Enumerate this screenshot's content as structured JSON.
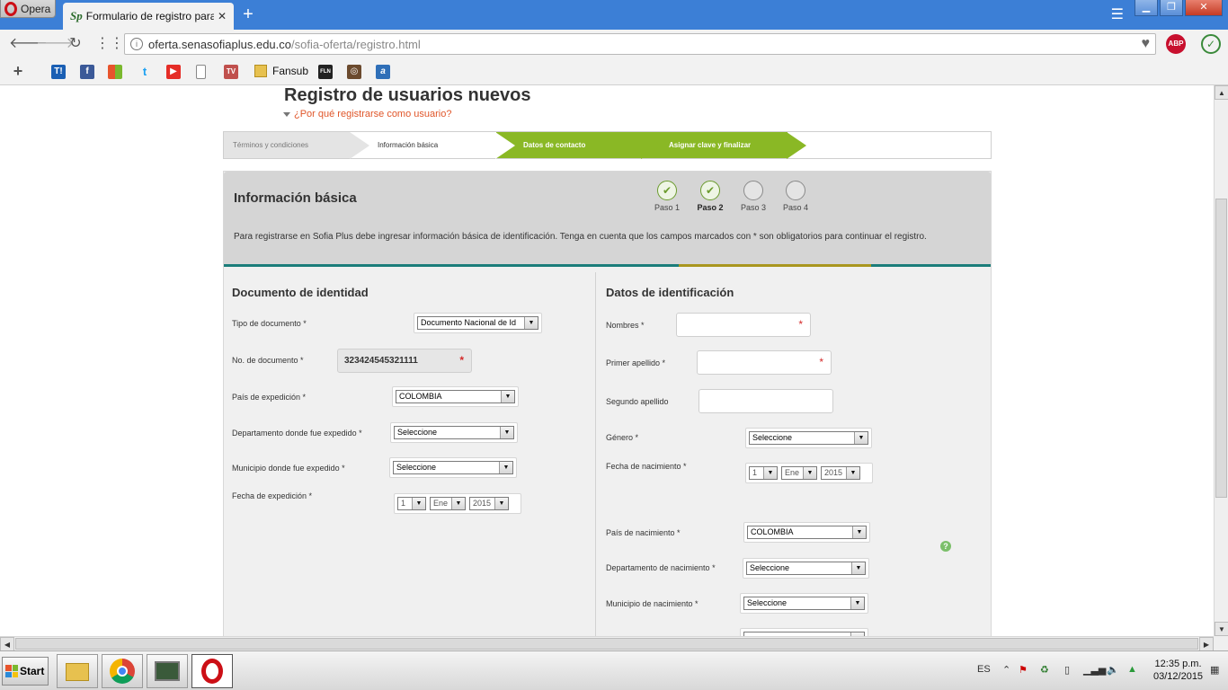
{
  "browser": {
    "menu_label": "Opera",
    "tab_title": "Formulario de registro para ι",
    "tab_favicon": "Sp",
    "url_domain": "oferta.senasofiaplus.edu.co",
    "url_path": "/sofia-oferta/registro.html",
    "abp_label": "ABP",
    "bookmarks": {
      "fansub_label": "Fansub",
      "items": [
        {
          "icon": "T!",
          "color": "#1a5fb4"
        },
        {
          "icon": "f",
          "color": "#3b5998"
        },
        {
          "icon": "",
          "color": "#e8542c"
        },
        {
          "icon": "t",
          "color": "#1da1f2"
        },
        {
          "icon": "▶",
          "color": "#e52d27"
        },
        {
          "icon": "",
          "color": "#888888"
        },
        {
          "icon": "TV",
          "color": "#c0504d"
        },
        {
          "icon": "FLN",
          "color": "#222222"
        },
        {
          "icon": "◎",
          "color": "#6b4a2e"
        },
        {
          "icon": "a",
          "color": "#2f6fb8"
        }
      ]
    }
  },
  "page": {
    "title": "Registro de usuarios nuevos",
    "why_link": "¿Por qué registrarse como usuario?",
    "steps_bar": [
      "Términos y condiciones",
      "Información básica",
      "Datos de contacto",
      "Asignar clave y finalizar"
    ],
    "panel": {
      "title": "Información básica",
      "description": "Para registrarse en Sofia Plus debe ingresar información básica de identificación. Tenga en cuenta que los campos marcados con * son obligatorios para continuar el registro.",
      "progress_steps": [
        {
          "label": "Paso 1",
          "done": true
        },
        {
          "label": "Paso 2",
          "done": true,
          "current": true
        },
        {
          "label": "Paso 3",
          "done": false
        },
        {
          "label": "Paso 4",
          "done": false
        }
      ]
    },
    "left": {
      "section": "Documento de identidad",
      "tipo_label": "Tipo de documento *",
      "tipo_value": "Documento Nacional de Id",
      "num_label": "No. de documento *",
      "num_value": "323424545321111",
      "pais_label": "País de expedición *",
      "pais_value": "COLOMBIA",
      "depto_label": "Departamento donde fue expedido *",
      "depto_value": "Seleccione",
      "muni_label": "Municipio donde fue expedido *",
      "muni_value": "Seleccione",
      "fecha_label": "Fecha de expedición *",
      "fecha_day": "1",
      "fecha_month": "Ene",
      "fecha_year": "2015"
    },
    "right": {
      "section": "Datos de identificación",
      "nombres_label": "Nombres *",
      "apellido1_label": "Primer apellido *",
      "apellido2_label": "Segundo apellido",
      "genero_label": "Género *",
      "genero_value": "Seleccione",
      "nac_label": "Fecha de nacimiento *",
      "nac_day": "1",
      "nac_month": "Ene",
      "nac_year": "2015",
      "pais_nac_label": "País de nacimiento *",
      "pais_nac_value": "COLOMBIA",
      "depto_nac_label": "Departamento de nacimiento *",
      "depto_nac_value": "Seleccione",
      "muni_nac_label": "Municipio de nacimiento *",
      "muni_nac_value": "Seleccione"
    },
    "required_star": "*"
  },
  "taskbar": {
    "start_label": "Start",
    "lang": "ES",
    "time": "12:35 p.m.",
    "date": "03/12/2015"
  }
}
